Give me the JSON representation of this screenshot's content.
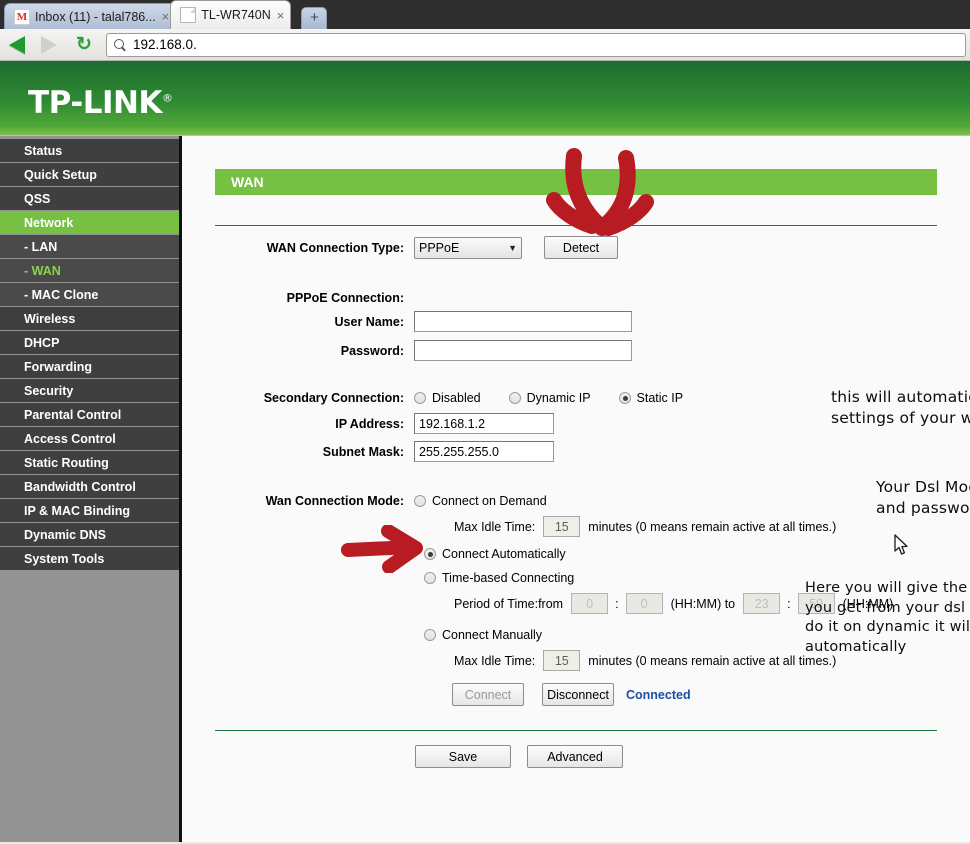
{
  "browser": {
    "tabs": [
      {
        "title": "Inbox (11) - talal786...",
        "favicon": "gmail-icon",
        "active": false,
        "close": "×"
      },
      {
        "title": "TL-WR740N",
        "favicon": "page-icon",
        "active": true,
        "close": "×"
      }
    ],
    "new_tab_label": "+",
    "back_label": "Back",
    "forward_label": "Forward",
    "reload_label": "↻",
    "url": "192.168.0.",
    "url_icon": "search-icon"
  },
  "brand": {
    "name": "TP-LINK",
    "registered": "®"
  },
  "sidebar": {
    "items": [
      {
        "label": "Status",
        "type": "top",
        "state": "normal"
      },
      {
        "label": "Quick Setup",
        "type": "top",
        "state": "normal"
      },
      {
        "label": "QSS",
        "type": "top",
        "state": "normal"
      },
      {
        "label": "Network",
        "type": "top",
        "state": "selected"
      },
      {
        "label": "- LAN",
        "type": "sub",
        "state": "normal"
      },
      {
        "label": "- WAN",
        "type": "sub",
        "state": "active"
      },
      {
        "label": "- MAC Clone",
        "type": "sub",
        "state": "normal"
      },
      {
        "label": "Wireless",
        "type": "top",
        "state": "normal"
      },
      {
        "label": "DHCP",
        "type": "top",
        "state": "normal"
      },
      {
        "label": "Forwarding",
        "type": "top",
        "state": "normal"
      },
      {
        "label": "Security",
        "type": "top",
        "state": "normal"
      },
      {
        "label": "Parental Control",
        "type": "top",
        "state": "normal"
      },
      {
        "label": "Access Control",
        "type": "top",
        "state": "normal"
      },
      {
        "label": "Static Routing",
        "type": "top",
        "state": "normal"
      },
      {
        "label": "Bandwidth Control",
        "type": "top",
        "state": "normal"
      },
      {
        "label": "IP & MAC Binding",
        "type": "top",
        "state": "normal"
      },
      {
        "label": "Dynamic DNS",
        "type": "top",
        "state": "normal"
      },
      {
        "label": "System Tools",
        "type": "top",
        "state": "normal"
      }
    ]
  },
  "page": {
    "title": "WAN",
    "wan_connection_type_label": "WAN Connection Type:",
    "wan_connection_type_value": "PPPoE",
    "detect_button": "Detect",
    "pppoe_connection_label": "PPPoE Connection:",
    "user_name_label": "User Name:",
    "user_name_value": "",
    "password_label": "Password:",
    "password_value": "",
    "secondary_connection_label": "Secondary Connection:",
    "secondary_options": [
      {
        "label": "Disabled",
        "selected": false
      },
      {
        "label": "Dynamic IP",
        "selected": false
      },
      {
        "label": "Static IP",
        "selected": true
      }
    ],
    "ip_address_label": "IP Address:",
    "ip_address_value": "192.168.1.2",
    "subnet_mask_label": "Subnet Mask:",
    "subnet_mask_value": "255.255.255.0",
    "wan_connection_mode_label": "Wan Connection Mode:",
    "mode_connect_on_demand": "Connect on Demand",
    "mode_connect_on_demand_selected": false,
    "max_idle_time_label_1": "Max Idle Time:",
    "max_idle_time_value_1": "15",
    "max_idle_time_suffix_1": "minutes (0 means remain active at all times.)",
    "mode_connect_automatically": "Connect Automatically",
    "mode_connect_automatically_selected": true,
    "mode_time_based": "Time-based Connecting",
    "mode_time_based_selected": false,
    "period_label": "Period of Time:from",
    "period_from_hh": "0",
    "period_from_mm": "0",
    "period_colon": ":",
    "period_hhmm_1": "(HH:MM) to",
    "period_to_hh": "23",
    "period_to_mm": "59",
    "period_hhmm_2": "(HH:MM)",
    "mode_connect_manually": "Connect Manually",
    "mode_connect_manually_selected": false,
    "max_idle_time_label_2": "Max Idle Time:",
    "max_idle_time_value_2": "15",
    "max_idle_time_suffix_2": "minutes (0 means remain active at all times.)",
    "connect_button": "Connect",
    "disconnect_button": "Disconnect",
    "connection_status": "Connected",
    "save_button": "Save",
    "advanced_button": "Advanced"
  },
  "annotations": {
    "note_detect": "this will automatically detect the\nsettings of your wan",
    "note_credentials": "Your Dsl Modem User name\nand password",
    "note_ip": "Here you will give the ip address of\nyou get from your dsl modem if you\ndo it on dynamic it will get ip\nautomatically",
    "arrow_down_name": "red-down-arrow",
    "arrow_right_name": "red-right-arrow",
    "arrow_color": "#b81c22"
  },
  "colors": {
    "tp_green": "#76c043",
    "header_dark_green": "#1d6b32",
    "sidebar_item": "#3f3f3f",
    "sidebar_bg": "#939393",
    "status_blue": "#1c4fa1",
    "annotation_red": "#b81c22"
  }
}
